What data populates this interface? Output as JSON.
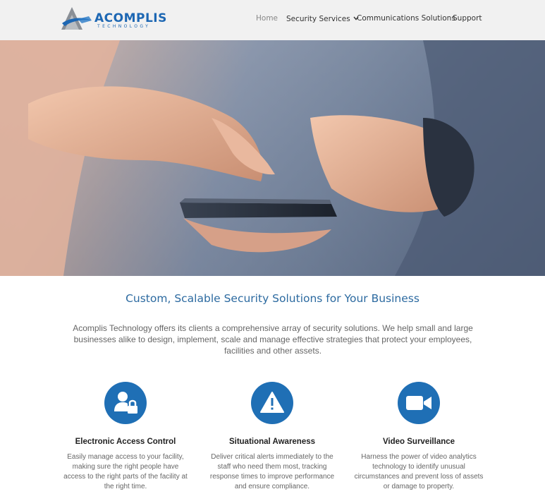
{
  "brand": {
    "name": "ACOMPLIS",
    "tagline": "TECHNOLOGY"
  },
  "nav": {
    "items": [
      {
        "label": "Home",
        "active": true
      },
      {
        "label": "Security Services",
        "has_dropdown": true
      },
      {
        "label": "Communications Solutions"
      },
      {
        "label": "Support"
      }
    ]
  },
  "hero": {
    "image": "hands-holding-smartphone-photo"
  },
  "content": {
    "heading": "Custom, Scalable Security Solutions for Your Business",
    "intro": "Acomplis Technology offers its clients a comprehensive array of security solutions. We help small and large businesses alike to design, implement, scale and manage effective strategies that protect your employees, facilities and other assets."
  },
  "features": [
    {
      "icon": "user-lock-icon",
      "title": "Electronic Access Control",
      "text": "Easily manage access to your facility, making sure the right people have access to the right parts of the facility at the right time."
    },
    {
      "icon": "warning-icon",
      "title": "Situational Awareness",
      "text": "Deliver critical alerts immediately to the staff who need them most, tracking response times to improve performance and ensure compliance."
    },
    {
      "icon": "video-camera-icon",
      "title": "Video Surveillance",
      "text": "Harness the power of video analytics technology to identify unusual circumstances and prevent loss of assets or damage to property."
    }
  ],
  "colors": {
    "brand_blue": "#1d67b3",
    "icon_blue": "#1f6fb5",
    "heading_blue": "#2c6aa0",
    "header_bg": "#f1f1f1"
  }
}
